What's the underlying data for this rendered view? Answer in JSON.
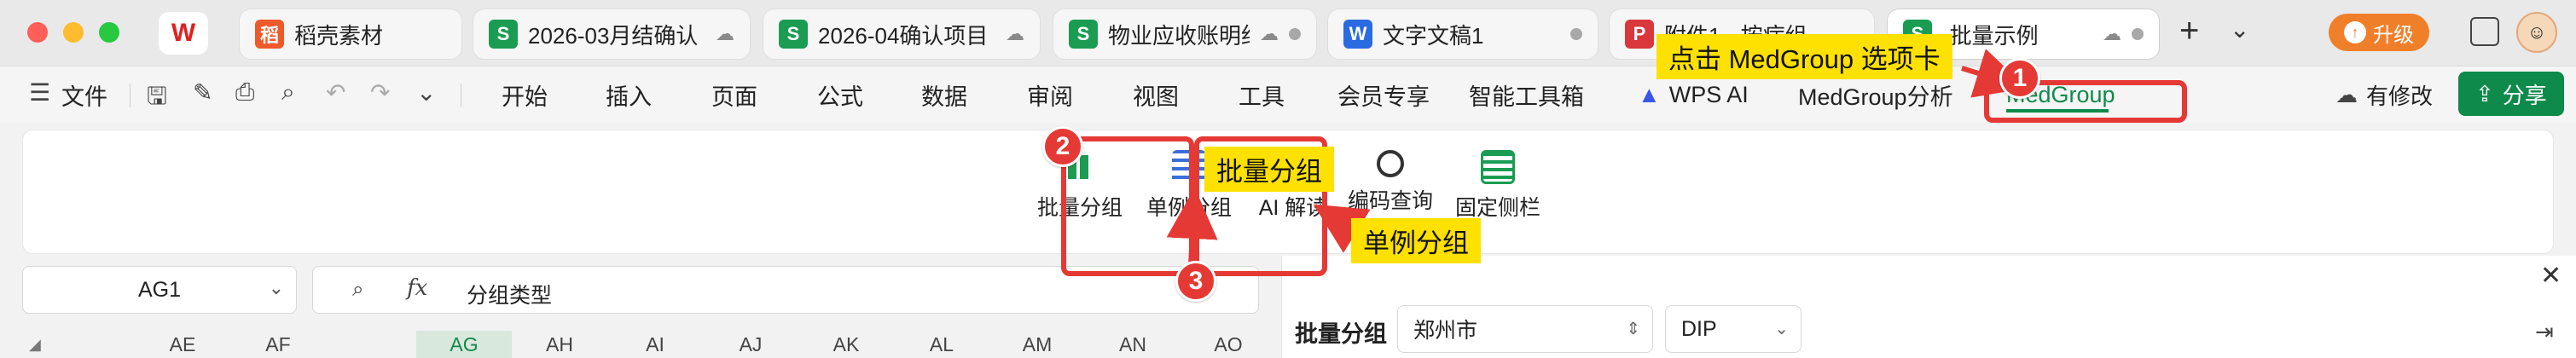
{
  "app": {
    "logo_text": "W"
  },
  "tabs": [
    {
      "label": "稻壳素材",
      "icon": "docer-icon",
      "icon_text": "稻"
    },
    {
      "label": "2026-03月结确认",
      "icon": "sheet-icon",
      "icon_text": "S"
    },
    {
      "label": "2026-04确认项目",
      "icon": "sheet-icon",
      "icon_text": "S"
    },
    {
      "label": "物业应收账明细",
      "icon": "sheet-icon",
      "icon_text": "S"
    },
    {
      "label": "文字文稿1",
      "icon": "word-icon",
      "icon_text": "W"
    },
    {
      "label": "附件1 - 按病组",
      "icon": "pdf-icon",
      "icon_text": "P"
    },
    {
      "label": "-批量示例",
      "icon": "sheet-icon",
      "icon_text": "S"
    }
  ],
  "topbar": {
    "plus": "+",
    "chevron": "⌄",
    "upgrade_label": "升级"
  },
  "menubar": {
    "file_label": "文件",
    "items": [
      "开始",
      "插入",
      "页面",
      "公式",
      "数据",
      "审阅",
      "视图",
      "工具",
      "会员专享",
      "智能工具箱"
    ],
    "wps_ai": "WPS AI",
    "medgroup_analysis": "MedGroup分析",
    "medgroup_tab": "MedGroup",
    "status_label": "有修改",
    "share_label": "分享"
  },
  "ribbon": {
    "buttons": [
      {
        "label": "批量分组",
        "icon": "batch-group-icon",
        "color": "#1a9c53"
      },
      {
        "label": "单例分组",
        "icon": "single-group-icon",
        "color": "#3a6fd8"
      },
      {
        "label": "AI 解读",
        "icon": "ai-interpret-icon",
        "color": "#2b6be2"
      },
      {
        "label": "编码查询",
        "icon": "code-search-icon",
        "color": "#1a9c53"
      },
      {
        "label": "固定侧栏",
        "icon": "pin-sidebar-icon",
        "color": "#1a9c53"
      }
    ]
  },
  "formula_bar": {
    "cell_ref": "AG1",
    "fx_symbol": "fx",
    "value": "分组类型"
  },
  "columns": [
    "AE",
    "AF",
    "AG",
    "AH",
    "AI",
    "AJ",
    "AK",
    "AL",
    "AM",
    "AN",
    "AO"
  ],
  "selected_column": "AG",
  "side_panel": {
    "title": "批量分组",
    "city": "郑州市",
    "mode": "DIP"
  },
  "annotations": {
    "label_1": "点击 MedGroup 选项卡",
    "label_2": "批量分组",
    "label_3": "单例分组",
    "badges": [
      "1",
      "2",
      "3"
    ],
    "color": "#e53935",
    "label_bg": "#ffe100"
  }
}
